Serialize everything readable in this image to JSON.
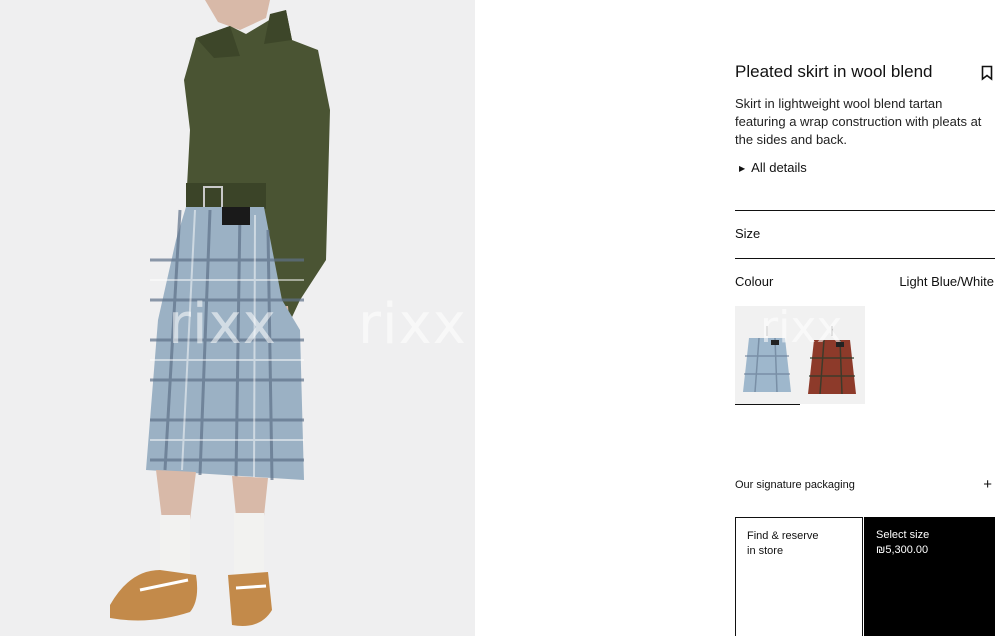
{
  "product": {
    "title": "Pleated skirt in wool blend",
    "description": "Skirt in lightweight wool blend tartan featuring a wrap construction with pleats at the sides and back.",
    "details_label": "All details",
    "bookmark_icon": "bookmark-icon"
  },
  "size": {
    "label": "Size"
  },
  "colour": {
    "label": "Colour",
    "selected": "Light Blue/White",
    "swatches": [
      {
        "name": "light-blue-white",
        "color": "#9eb7cc",
        "selected": true
      },
      {
        "name": "red-tartan",
        "color": "#8d3a2a",
        "selected": false
      }
    ]
  },
  "packaging": {
    "label": "Our signature packaging",
    "icon": "plus-icon"
  },
  "cta": {
    "find_line1": "Find & reserve",
    "find_line2": "in store",
    "select_size": "Select size",
    "price": "₪5,300.00"
  },
  "watermark": "rixx",
  "colors": {
    "hero_bg": "#efeff0",
    "jacket": "#4a5433",
    "cta_bg": "#000000"
  }
}
